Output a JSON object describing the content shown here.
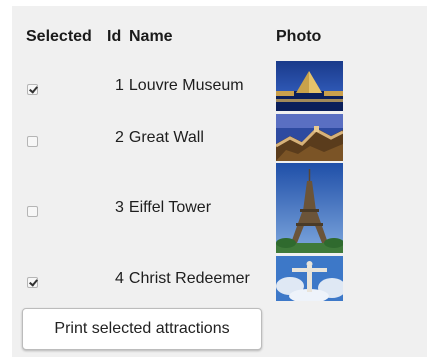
{
  "table": {
    "headers": {
      "selected": "Selected",
      "id": "Id",
      "name": "Name",
      "photo": "Photo"
    },
    "rows": [
      {
        "id": "1",
        "name": "Louvre Museum",
        "selected": true,
        "photo_icon": "louvre-pyramid-photo"
      },
      {
        "id": "2",
        "name": "Great Wall",
        "selected": false,
        "photo_icon": "great-wall-photo"
      },
      {
        "id": "3",
        "name": "Eiffel Tower",
        "selected": false,
        "photo_icon": "eiffel-tower-photo"
      },
      {
        "id": "4",
        "name": "Christ Redeemer",
        "selected": true,
        "photo_icon": "christ-redeemer-photo"
      }
    ]
  },
  "actions": {
    "print_label": "Print selected attractions"
  }
}
